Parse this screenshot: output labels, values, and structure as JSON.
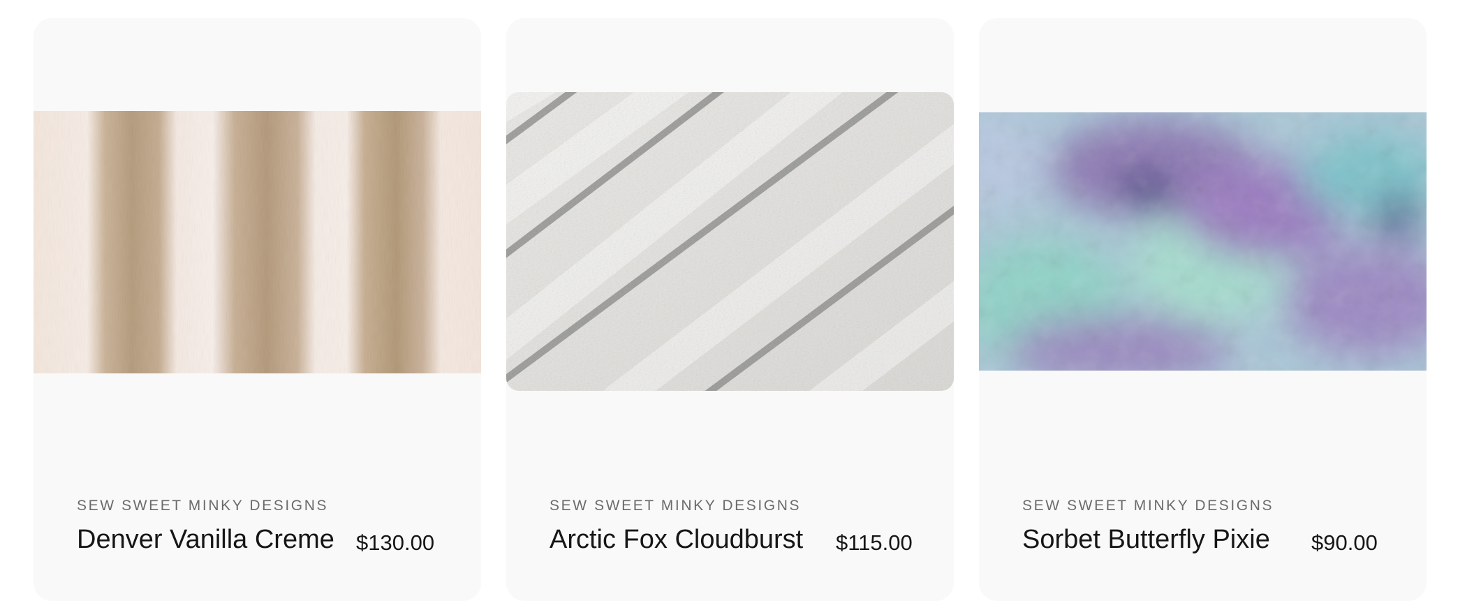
{
  "products": [
    {
      "vendor": "SEW SWEET MINKY DESIGNS",
      "title": "Denver Vanilla Creme",
      "price": "$130.00",
      "image": "denver-vanilla-creme-fabric-swatch"
    },
    {
      "vendor": "SEW SWEET MINKY DESIGNS",
      "title": "Arctic Fox Cloudburst",
      "price": "$115.00",
      "image": "arctic-fox-cloudburst-fabric-swatch"
    },
    {
      "vendor": "SEW SWEET MINKY DESIGNS",
      "title": "Sorbet Butterfly Pixie",
      "price": "$90.00",
      "image": "sorbet-butterfly-pixie-fabric-swatch"
    }
  ],
  "colors": {
    "card_background": "#f9f9f9",
    "text_primary": "#161616",
    "text_muted": "#6b6b6b"
  }
}
